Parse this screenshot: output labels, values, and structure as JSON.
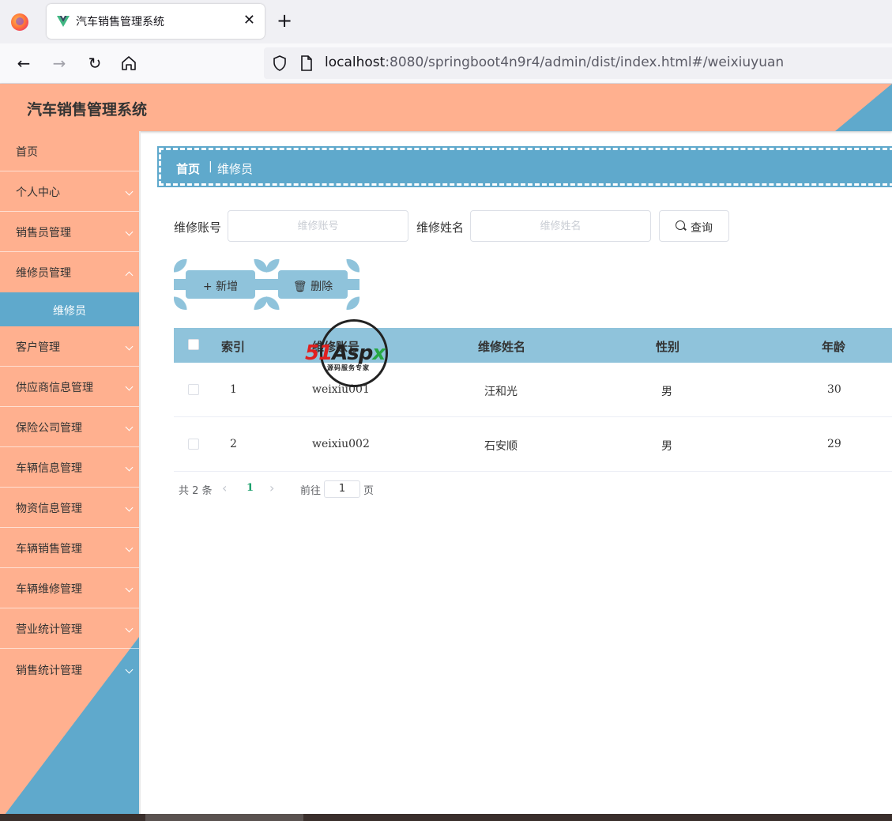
{
  "browser": {
    "tab_title": "汽车销售管理系统",
    "tab_close": "✕",
    "new_tab": "+",
    "url_host": "localhost",
    "url_rest": ":8080/springboot4n9r4/admin/dist/index.html#/weixiuyuan"
  },
  "header": {
    "title": "汽车销售管理系统"
  },
  "sidebar": {
    "items": [
      {
        "label": "首页"
      },
      {
        "label": "个人中心"
      },
      {
        "label": "销售员管理"
      },
      {
        "label": "维修员管理"
      },
      {
        "label": "客户管理"
      },
      {
        "label": "供应商信息管理"
      },
      {
        "label": "保险公司管理"
      },
      {
        "label": "车辆信息管理"
      },
      {
        "label": "物资信息管理"
      },
      {
        "label": "车辆销售管理"
      },
      {
        "label": "车辆维修管理"
      },
      {
        "label": "营业统计管理"
      },
      {
        "label": "销售统计管理"
      }
    ],
    "active_sub": "维修员"
  },
  "breadcrumb": {
    "home": "首页",
    "sep": "|",
    "current": "维修员"
  },
  "search": {
    "account_label": "维修账号",
    "account_placeholder": "维修账号",
    "name_label": "维修姓名",
    "name_placeholder": "维修姓名",
    "query_label": "查询"
  },
  "actions": {
    "add_label": "+ 新增",
    "delete_label": "删除"
  },
  "table": {
    "headers": [
      "索引",
      "维修账号",
      "维修姓名",
      "性别",
      "年龄"
    ],
    "rows": [
      {
        "index": "1",
        "account": "weixiu001",
        "name": "汪和光",
        "gender": "男",
        "age": "30"
      },
      {
        "index": "2",
        "account": "weixiu002",
        "name": "石安顺",
        "gender": "男",
        "age": "29"
      }
    ]
  },
  "pager": {
    "total": "共 2 条",
    "prev": "‹",
    "page": "1",
    "next": "›",
    "goto": "前往",
    "goto_value": "1",
    "goto_unit": "页"
  },
  "watermark": {
    "brand": "51Aspx",
    "tagline": "源码服务专家"
  },
  "colors": {
    "peach": "#ffb08f",
    "blue": "#5fa9cc",
    "light_blue": "#8fc3db",
    "active_page": "#1aa06b"
  }
}
